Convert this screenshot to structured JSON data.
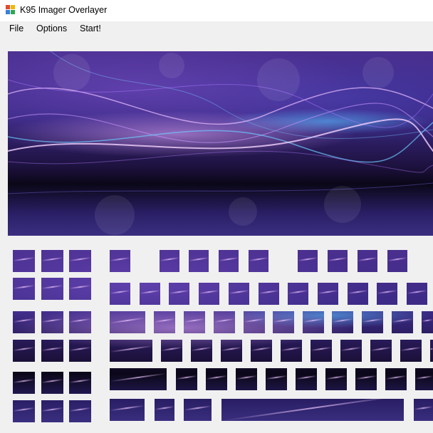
{
  "window": {
    "title": "K95 Imager Overlayer"
  },
  "menu": {
    "items": [
      "File",
      "Options",
      "Start!"
    ]
  },
  "preview": {
    "description_icon": "purple-abstract-wave-image"
  },
  "colors": {
    "window_bg": "#f0f0f0",
    "titlebar_bg": "#ffffff",
    "image_purple": "#3b2a86",
    "image_dark": "#0b0718",
    "image_highlight": "#e6aaff",
    "image_blue": "#5abeff"
  }
}
